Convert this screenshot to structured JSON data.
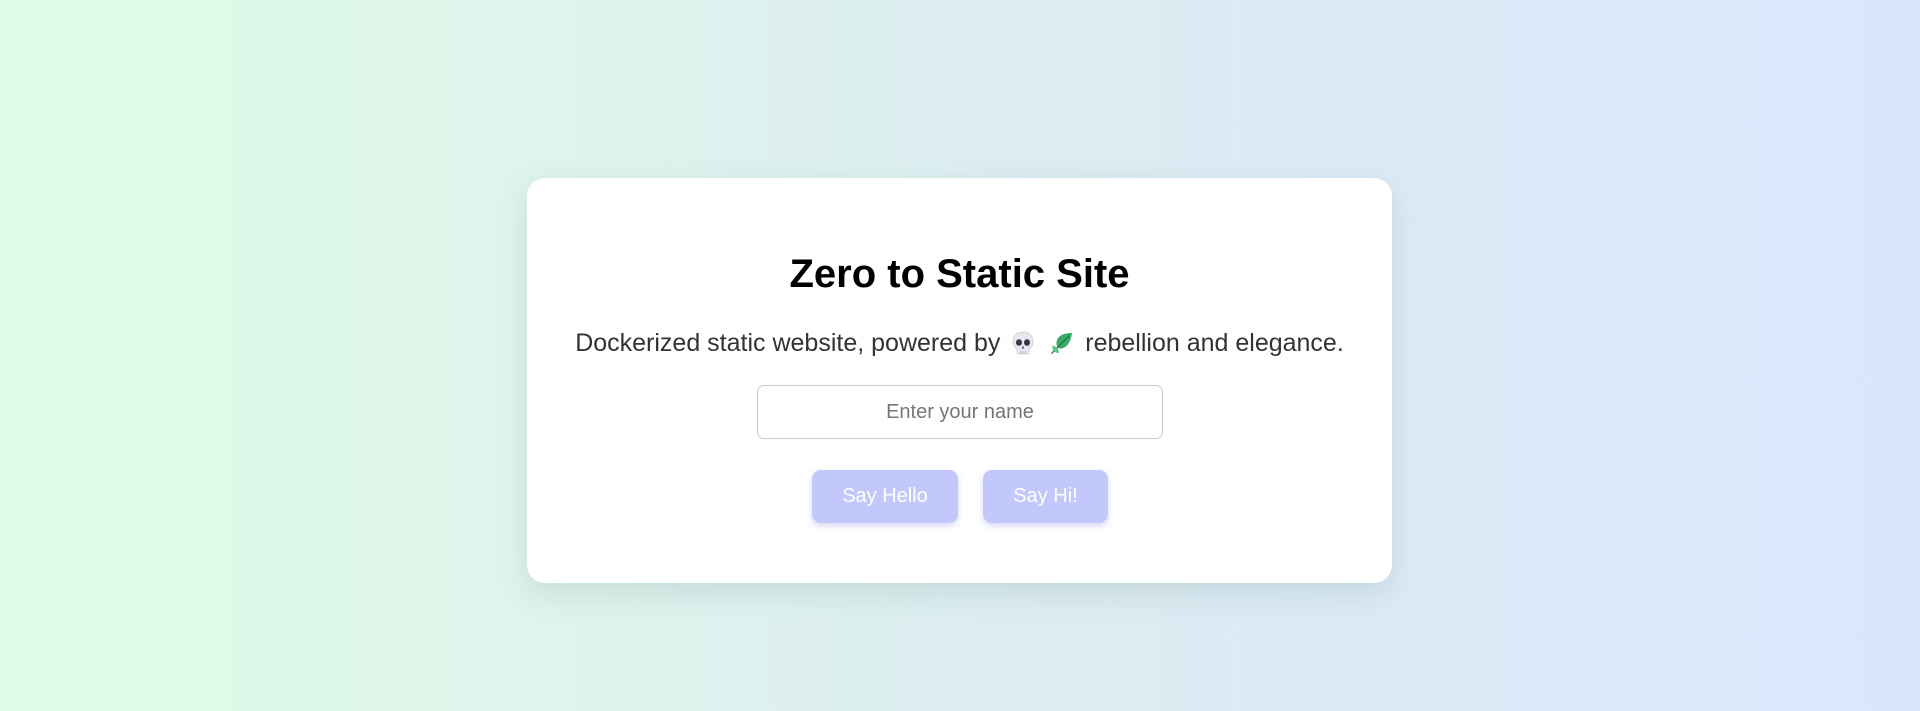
{
  "page": {
    "title": "Zero to Static Site",
    "subtitle_prefix": "Dockerized static website, powered by",
    "subtitle_suffix": "rebellion and elegance.",
    "subtitle_icons": [
      "skull-icon",
      "leaf-icon"
    ]
  },
  "form": {
    "name_placeholder": "Enter your name",
    "name_value": ""
  },
  "buttons": {
    "hello_label": "Say Hello",
    "hi_label": "Say Hi!"
  },
  "colors": {
    "button_bg": "#c2c7fc",
    "button_text": "#ffffff",
    "background_left": "#dffde6",
    "background_right": "#d9e7fd"
  }
}
